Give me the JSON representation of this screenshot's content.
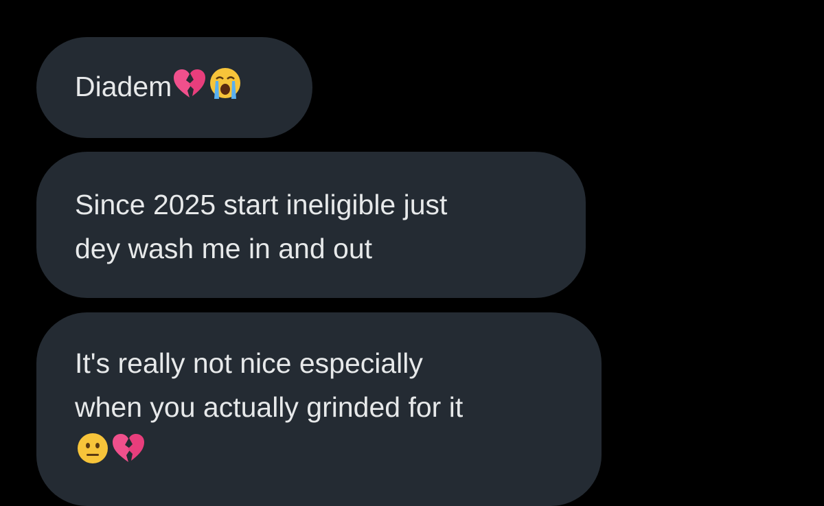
{
  "messages": [
    {
      "lines": [
        "Diadem"
      ],
      "trailing_emojis": [
        "broken-heart",
        "loudly-crying-face"
      ]
    },
    {
      "lines": [
        "Since 2025 start ineligible just",
        "dey wash me in and out"
      ],
      "trailing_emojis": []
    },
    {
      "lines": [
        "It's really not nice especially",
        "when you actually grinded for it"
      ],
      "trailing_emojis": [
        "neutral-face",
        "broken-heart"
      ]
    }
  ],
  "colors": {
    "background": "#000000",
    "bubble": "#242b33",
    "text": "#e7e9ea",
    "heart": "#f0508c"
  }
}
